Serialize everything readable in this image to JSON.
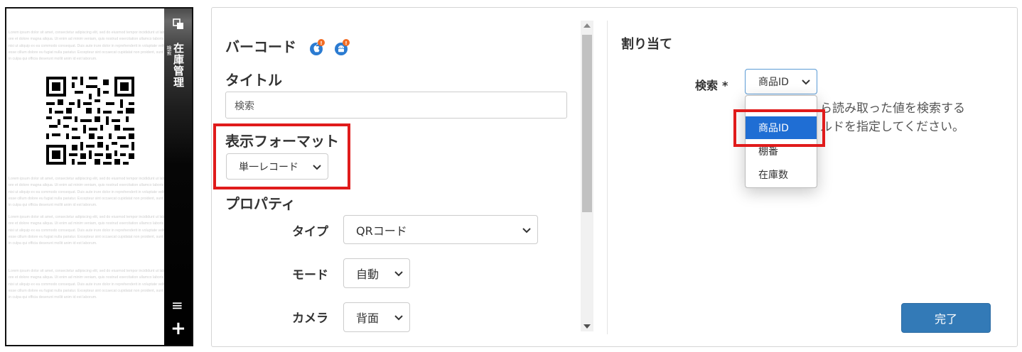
{
  "preview": {
    "app_title": "在庫管理",
    "app_subtitle": "検索",
    "lorem_text": "Lorem ipsum dolor sit amet, consectetur adipiscing elit, sed do eiusmod tempor incididunt ut labore et dolore magna aliqua. Ut enim ad minim veniam, quis nostrud exercitation ullamco laboris nisi ut aliquip ex ea commodo consequat. Duis aute irure dolor in reprehenderit in voluptate velit esse cillum dolore eu fugiat nulla pariatur. Excepteur sint occaecat cupidatat non proident, sunt in culpa qui officia deserunt mollit anim id est laborum.",
    "menu_icon": "hamburger-icon",
    "add_icon": "plus-icon"
  },
  "settings": {
    "barcode_heading": "バーコード",
    "title_heading": "タイトル",
    "title_value": "検索",
    "format_heading": "表示フォーマット",
    "format_value": "単一レコード",
    "properties_heading": "プロパティ",
    "type_label": "タイプ",
    "type_value": "QRコード",
    "mode_label": "モード",
    "mode_value": "自動",
    "camera_label": "カメラ",
    "camera_value": "背面"
  },
  "assign": {
    "heading": "割り当て",
    "search_label": "検索",
    "required_mark": "*",
    "search_value": "商品ID",
    "help_line1": "ら読み取った値を検索する",
    "help_line2": "ルドを指定してください。",
    "options": [
      "商品ID",
      "棚番",
      "在庫数"
    ],
    "selected_index": 0
  },
  "actions": {
    "done_label": "完了"
  },
  "colors": {
    "accent_red": "#e01b1b",
    "primary_button": "#337ab7",
    "dropdown_selected": "#1f6ed4",
    "ios_badge": "#2b7bd1",
    "notification_dot": "#f26b22"
  }
}
